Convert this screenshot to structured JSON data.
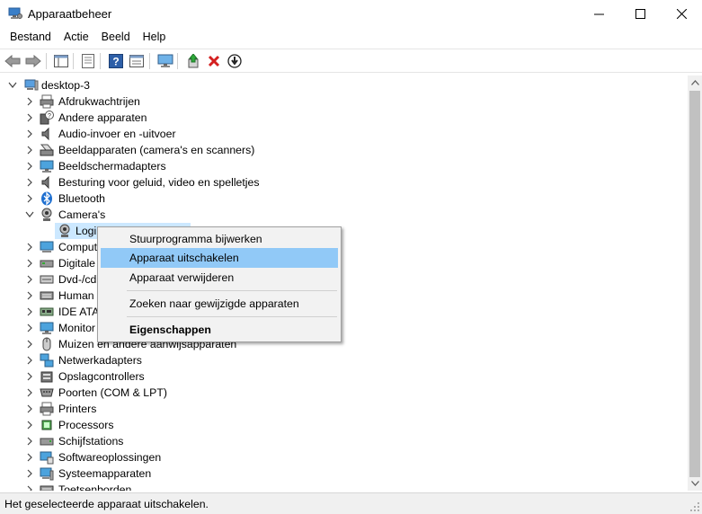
{
  "window": {
    "title": "Apparaatbeheer",
    "app_icon": "device-manager-icon"
  },
  "menubar": {
    "items": [
      {
        "label": "Bestand"
      },
      {
        "label": "Actie"
      },
      {
        "label": "Beeld"
      },
      {
        "label": "Help"
      }
    ]
  },
  "toolbar": {
    "buttons": [
      {
        "icon": "back-arrow-icon"
      },
      {
        "icon": "forward-arrow-icon"
      },
      {
        "icon": "properties-grid-icon"
      },
      {
        "icon": "document-list-icon"
      },
      {
        "icon": "help-icon"
      },
      {
        "icon": "properties-sheet-icon"
      },
      {
        "icon": "monitor-scan-icon"
      },
      {
        "icon": "update-driver-icon"
      },
      {
        "icon": "uninstall-x-icon"
      },
      {
        "icon": "disable-device-icon"
      }
    ]
  },
  "tree": {
    "root": {
      "label": "desktop-3",
      "icon": "computer-icon"
    },
    "items": [
      {
        "label": "Afdrukwachtrijen",
        "icon": "printer-queue-icon",
        "expanded": false
      },
      {
        "label": "Andere apparaten",
        "icon": "unknown-device-icon",
        "expanded": false
      },
      {
        "label": "Audio-invoer en -uitvoer",
        "icon": "speaker-icon",
        "expanded": false
      },
      {
        "label": "Beeldapparaten (camera's en scanners)",
        "icon": "scanner-icon",
        "expanded": false
      },
      {
        "label": "Beeldschermadapters",
        "icon": "display-adapter-icon",
        "expanded": false
      },
      {
        "label": "Besturing voor geluid, video en spelletjes",
        "icon": "sound-icon",
        "expanded": false
      },
      {
        "label": "Bluetooth",
        "icon": "bluetooth-icon",
        "expanded": false
      },
      {
        "label": "Camera's",
        "icon": "webcam-icon",
        "expanded": true
      },
      {
        "label": "Logi",
        "icon": "webcam-icon",
        "child": true,
        "selected": true
      },
      {
        "label": "Comput",
        "icon": "computer-icon",
        "expanded": false
      },
      {
        "label": "Digitale",
        "icon": "drive-icon",
        "expanded": false
      },
      {
        "label": "Dvd-/cd",
        "icon": "dvd-drive-icon",
        "expanded": false
      },
      {
        "label": "Human",
        "icon": "keyboard-icon",
        "expanded": false
      },
      {
        "label": "IDE ATA/",
        "icon": "ide-controller-icon",
        "expanded": false
      },
      {
        "label": "Monitor",
        "icon": "monitor-icon",
        "expanded": false
      },
      {
        "label": "Muizen en andere aanwijsapparaten",
        "icon": "mouse-icon",
        "expanded": false
      },
      {
        "label": "Netwerkadapters",
        "icon": "network-icon",
        "expanded": false
      },
      {
        "label": "Opslagcontrollers",
        "icon": "storage-controller-icon",
        "expanded": false
      },
      {
        "label": "Poorten (COM & LPT)",
        "icon": "port-icon",
        "expanded": false
      },
      {
        "label": "Printers",
        "icon": "printer-icon",
        "expanded": false
      },
      {
        "label": "Processors",
        "icon": "processor-icon",
        "expanded": false
      },
      {
        "label": "Schijfstations",
        "icon": "disk-drive-icon",
        "expanded": false
      },
      {
        "label": "Softwareoplossingen",
        "icon": "software-icon",
        "expanded": false
      },
      {
        "label": "Systeemapparaten",
        "icon": "system-device-icon",
        "expanded": false
      },
      {
        "label": "Toetsenborden",
        "icon": "keyboard-icon",
        "expanded": false
      }
    ]
  },
  "context_menu": {
    "items": [
      {
        "label": "Stuurprogramma bijwerken"
      },
      {
        "label": "Apparaat uitschakelen",
        "highlighted": true
      },
      {
        "label": "Apparaat verwijderen"
      },
      {
        "separator": true
      },
      {
        "label": "Zoeken naar gewijzigde apparaten"
      },
      {
        "separator": true
      },
      {
        "label": "Eigenschappen",
        "bold": true
      }
    ]
  },
  "statusbar": {
    "text": "Het geselecteerde apparaat uitschakelen."
  },
  "colors": {
    "selection": "#cce8ff",
    "menu_highlight": "#91c9f7",
    "menu_bg": "#f2f2f2",
    "status_bg": "#f0f0f0"
  }
}
